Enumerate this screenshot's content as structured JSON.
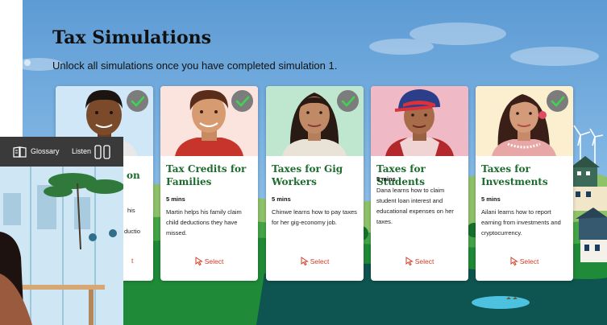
{
  "page": {
    "title": "Tax Simulations",
    "subtitle": "Unlock all simulations once you have completed simulation 1."
  },
  "cards": [
    {
      "title": "",
      "duration": "",
      "description": "",
      "select_label": "",
      "completed": true,
      "bg": "#cfe7f6"
    },
    {
      "title": "Tax Credits for Families",
      "duration": "5 mins",
      "description": "Martin helps his family claim child deductions they have missed.",
      "select_label": "Select",
      "completed": true,
      "bg": "#fbe4dd"
    },
    {
      "title": "Taxes for Gig Workers",
      "duration": "5 mins",
      "description": "Chinwe learns how to pay taxes for her gig-economy job.",
      "select_label": "Select",
      "completed": true,
      "bg": "#bfe6cf"
    },
    {
      "title": "Taxes for Students",
      "duration": "5 mins",
      "description": "Dana learns how to claim student loan interest and educational expenses on her taxes.",
      "select_label": "Select",
      "completed": false,
      "bg": "#f0b9c6"
    },
    {
      "title": "Taxes for Investments",
      "duration": "5 mins",
      "description": "Ailani learns how to report earning from investments and cryptocurrency.",
      "select_label": "Select",
      "completed": true,
      "bg": "#fcefcf"
    }
  ],
  "partial_card": {
    "title_fragment": "on",
    "description_fragments": [
      "his",
      "ductio"
    ],
    "select_fragment": "t"
  },
  "toolbar": {
    "glossary_label": "Glossary",
    "listen_label": "Listen"
  },
  "colors": {
    "card_title": "#1d6b2e",
    "select": "#d23b24",
    "check": "#3fd44f",
    "grass": "#1f8a37",
    "sky": "#6aa6dc"
  }
}
